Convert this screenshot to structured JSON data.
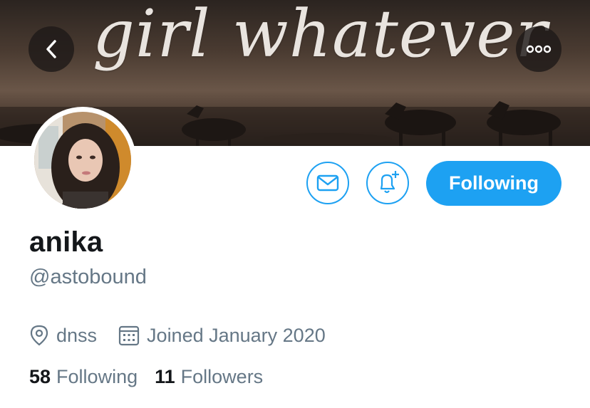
{
  "header": {
    "banner_text": "girl whatever",
    "back_icon": "chevron-left-icon",
    "more_icon": "more-horizontal-icon"
  },
  "actions": {
    "message_icon": "mail-icon",
    "notify_icon": "bell-plus-icon",
    "follow_label": "Following"
  },
  "profile": {
    "name": "anika",
    "handle": "@astobound",
    "location": "dnss",
    "joined": "Joined January 2020",
    "following_count": "58",
    "following_label": "Following",
    "followers_count": "11",
    "followers_label": "Followers"
  },
  "colors": {
    "accent": "#1da1f2",
    "secondary_text": "#657786",
    "primary_text": "#14171a"
  }
}
